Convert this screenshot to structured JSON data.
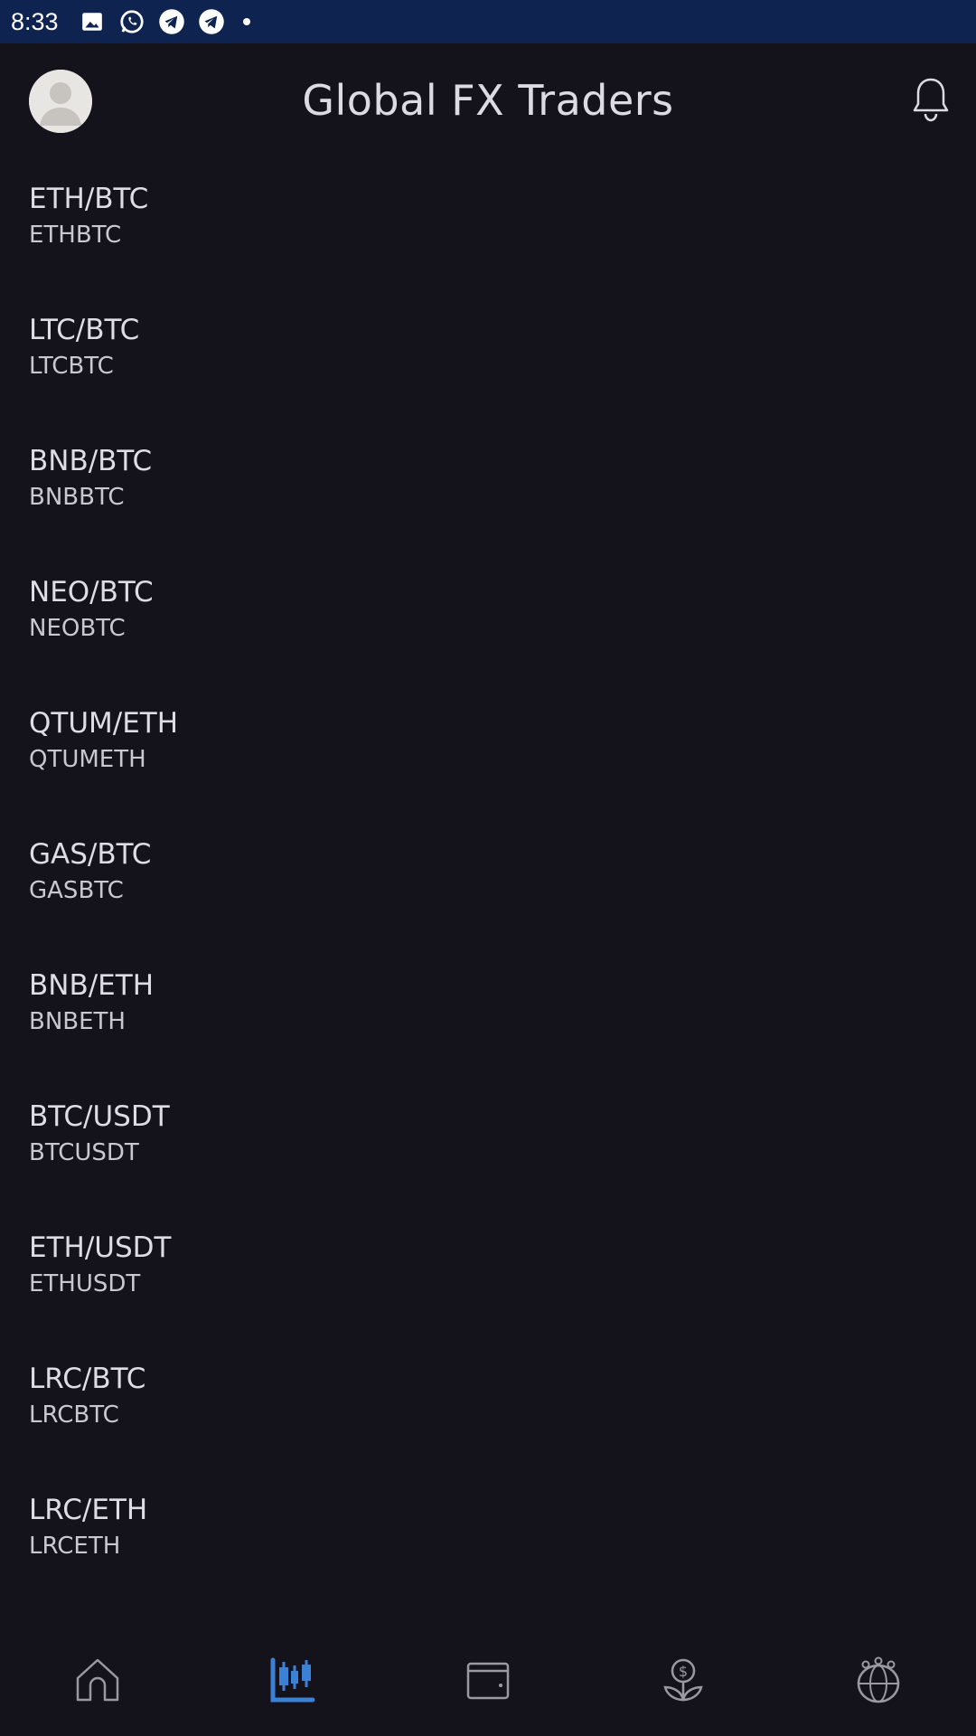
{
  "status_bar": {
    "time": "8:33",
    "icons": [
      "gallery-icon",
      "whatsapp-icon",
      "telegram-icon",
      "telegram-icon",
      "dot-icon"
    ]
  },
  "header": {
    "title": "Global FX Traders",
    "avatar_icon": "user-avatar-icon",
    "notification_icon": "bell-icon"
  },
  "pairs": [
    {
      "name": "ETH/BTC",
      "symbol": "ETHBTC"
    },
    {
      "name": "LTC/BTC",
      "symbol": "LTCBTC"
    },
    {
      "name": "BNB/BTC",
      "symbol": "BNBBTC"
    },
    {
      "name": "NEO/BTC",
      "symbol": "NEOBTC"
    },
    {
      "name": "QTUM/ETH",
      "symbol": "QTUMETH"
    },
    {
      "name": "GAS/BTC",
      "symbol": "GASBTC"
    },
    {
      "name": "BNB/ETH",
      "symbol": "BNBETH"
    },
    {
      "name": "BTC/USDT",
      "symbol": "BTCUSDT"
    },
    {
      "name": "ETH/USDT",
      "symbol": "ETHUSDT"
    },
    {
      "name": "LRC/BTC",
      "symbol": "LRCBTC"
    },
    {
      "name": "LRC/ETH",
      "symbol": "LRCETH"
    }
  ],
  "bottom_nav": {
    "items": [
      {
        "icon": "home-icon",
        "active": false
      },
      {
        "icon": "candlestick-chart-icon",
        "active": true
      },
      {
        "icon": "wallet-icon",
        "active": false
      },
      {
        "icon": "dollar-plant-icon",
        "active": false
      },
      {
        "icon": "community-globe-icon",
        "active": false
      }
    ],
    "active_color": "#3b82d6",
    "inactive_color": "#9a99a2"
  },
  "colors": {
    "background": "#14121a",
    "status_bar": "#0f2350",
    "text_primary": "#dedde4"
  }
}
